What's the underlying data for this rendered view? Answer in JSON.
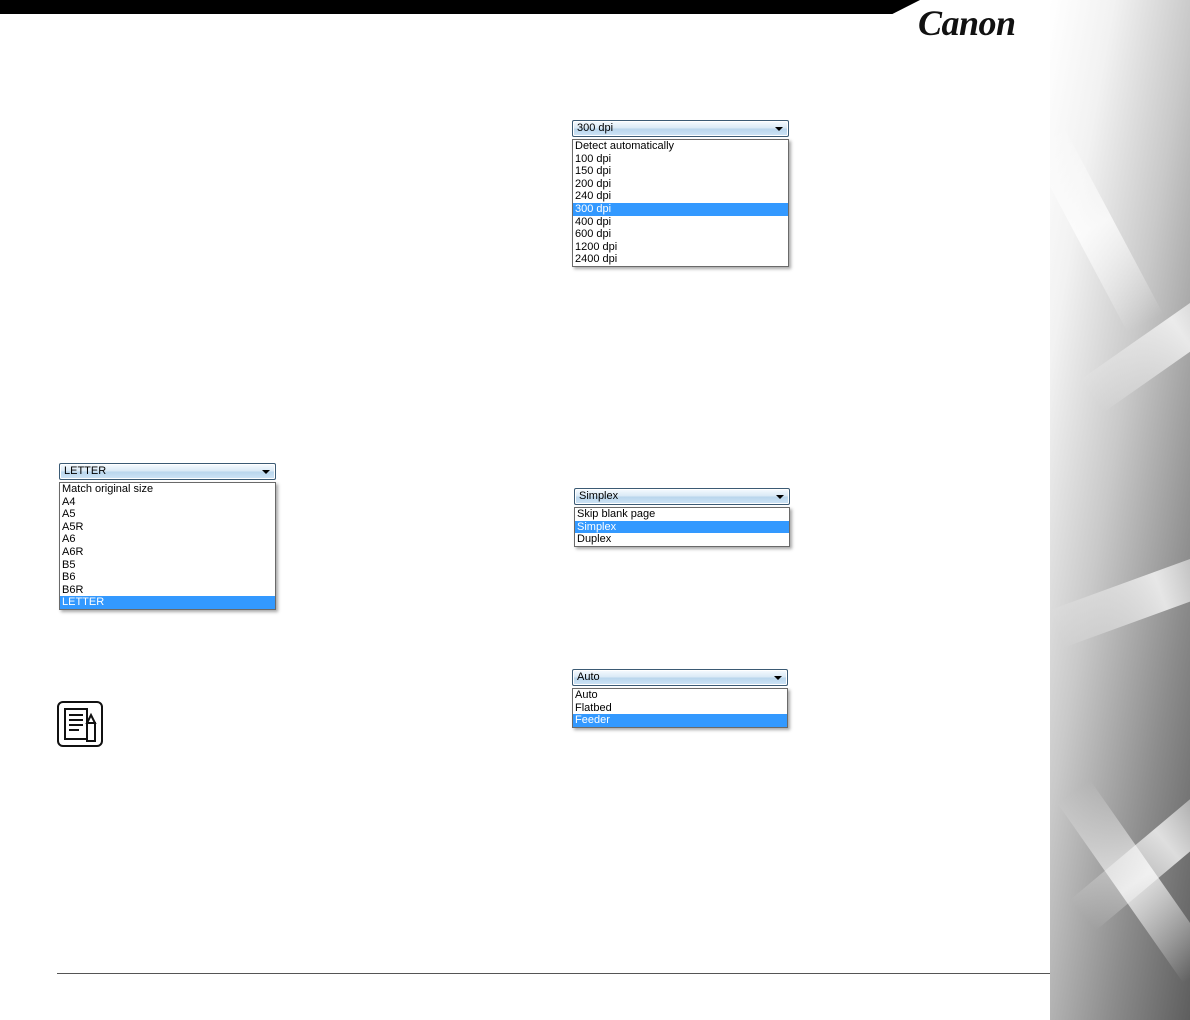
{
  "brand": {
    "logo": "Canon"
  },
  "resolution": {
    "selected": "300 dpi",
    "options": [
      "Detect automatically",
      "100 dpi",
      "150 dpi",
      "200 dpi",
      "240 dpi",
      "300 dpi",
      "400 dpi",
      "600 dpi",
      "1200 dpi",
      "2400 dpi"
    ],
    "highlighted_index": 5
  },
  "paper_size": {
    "selected": "LETTER",
    "options": [
      "Match original size",
      "A4",
      "A5",
      "A5R",
      "A6",
      "A6R",
      "B5",
      "B6",
      "B6R",
      "LETTER"
    ],
    "highlighted_index": 9
  },
  "scanning_side": {
    "selected": "Simplex",
    "options": [
      "Skip blank page",
      "Simplex",
      "Duplex"
    ],
    "highlighted_index": 1
  },
  "scan_source": {
    "selected": "Auto",
    "options": [
      "Auto",
      "Flatbed",
      "Feeder"
    ],
    "highlighted_index": 2
  },
  "colors": {
    "highlight": "#3399ff",
    "top_bar": "#000000"
  },
  "icons": {
    "note": "note-pencil-icon",
    "dropdown_arrow": "chevron-down-icon"
  }
}
